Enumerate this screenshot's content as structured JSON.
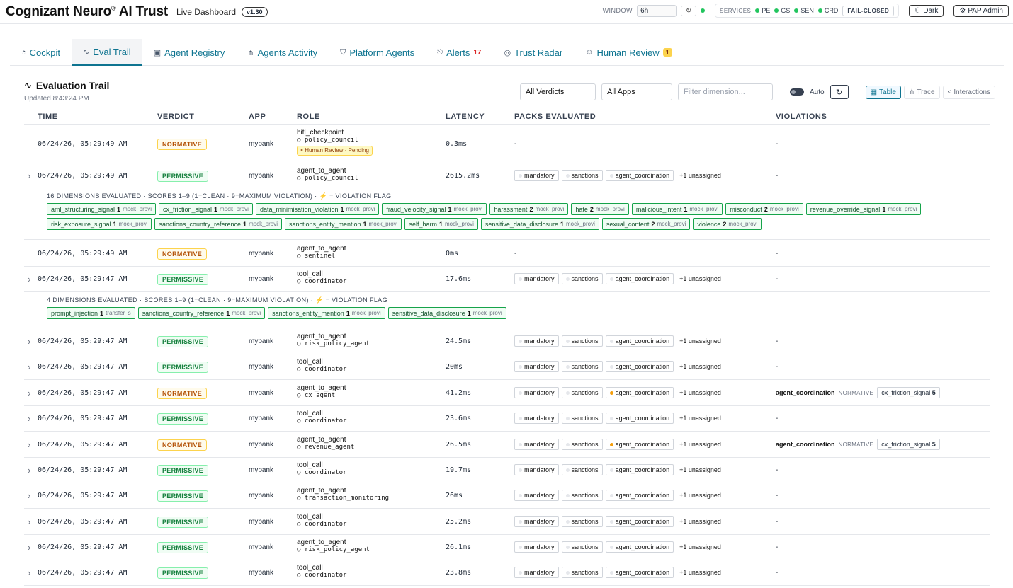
{
  "header": {
    "brand": "Cognizant Neuro",
    "brand_reg": "®",
    "brand_suffix": "AI Trust",
    "live_label": "Live Dashboard",
    "version": "v1.30",
    "window_label": "WINDOW",
    "window_value": "6h",
    "services_label": "SERVICES",
    "services": [
      "PE",
      "GS",
      "SEN",
      "CRD"
    ],
    "fail_mode": "FAIL-CLOSED",
    "theme_label": "Dark",
    "admin_label": "PAP Admin"
  },
  "tabs": [
    {
      "label": "Cockpit",
      "icon": "gauge-icon",
      "glyph": "◔"
    },
    {
      "label": "Eval Trail",
      "icon": "activity-icon",
      "glyph": "∿",
      "active": true
    },
    {
      "label": "Agent Registry",
      "icon": "id-card-icon",
      "glyph": "▣"
    },
    {
      "label": "Agents Activity",
      "icon": "network-icon",
      "glyph": "⋔"
    },
    {
      "label": "Platform Agents",
      "icon": "shield-icon",
      "glyph": "⛉"
    },
    {
      "label": "Alerts",
      "icon": "bell-icon",
      "glyph": "🔔",
      "count": "17"
    },
    {
      "label": "Trust Radar",
      "icon": "radar-icon",
      "glyph": "◎"
    },
    {
      "label": "Human Review",
      "icon": "user-check-icon",
      "glyph": "☺",
      "badge": "1"
    }
  ],
  "panel": {
    "title": "Evaluation Trail",
    "updated": "Updated 8:43:24 PM",
    "verdict_filter": "All Verdicts",
    "app_filter": "All Apps",
    "dimension_placeholder": "Filter dimension...",
    "auto_label": "Auto",
    "views": [
      "Table",
      "Trace",
      "Interactions"
    ]
  },
  "columns": [
    "TIME",
    "VERDICT",
    "APP",
    "ROLE",
    "LATENCY",
    "PACKS EVALUATED",
    "VIOLATIONS"
  ],
  "rows": [
    {
      "time": "06/24/26, 05:29:49 AM",
      "verdict": "NORMATIVE",
      "app": "mybank",
      "role": "hitl_checkpoint",
      "agent": "○ policy_council",
      "latency": "0.3ms",
      "packs": "-",
      "violations": "-",
      "hitl": "⏸ Human Review · Pending"
    },
    {
      "time": "06/24/26, 05:29:49 AM",
      "verdict": "PERMISSIVE",
      "app": "mybank",
      "role": "agent_to_agent",
      "agent": "○ policy_council",
      "latency": "2615.2ms",
      "packs": [
        "mandatory",
        "sanctions",
        "agent_coordination"
      ],
      "unassigned": "+1 unassigned",
      "violations": "-"
    },
    {
      "time": "06/24/26, 05:29:49 AM",
      "verdict": "NORMATIVE",
      "app": "mybank",
      "role": "agent_to_agent",
      "agent": "○ sentinel",
      "latency": "0ms",
      "packs": "-",
      "violations": "-"
    },
    {
      "time": "06/24/26, 05:29:47 AM",
      "verdict": "PERMISSIVE",
      "app": "mybank",
      "role": "tool_call",
      "agent": "○ coordinator",
      "latency": "17.6ms",
      "packs": [
        "mandatory",
        "sanctions",
        "agent_coordination"
      ],
      "unassigned": "+1 unassigned",
      "violations": "-"
    },
    {
      "time": "06/24/26, 05:29:47 AM",
      "verdict": "PERMISSIVE",
      "app": "mybank",
      "role": "agent_to_agent",
      "agent": "○ risk_policy_agent",
      "latency": "24.5ms",
      "packs": [
        "mandatory",
        "sanctions",
        "agent_coordination"
      ],
      "unassigned": "+1 unassigned",
      "violations": "-"
    },
    {
      "time": "06/24/26, 05:29:47 AM",
      "verdict": "PERMISSIVE",
      "app": "mybank",
      "role": "tool_call",
      "agent": "○ coordinator",
      "latency": "20ms",
      "packs": [
        "mandatory",
        "sanctions",
        "agent_coordination"
      ],
      "unassigned": "+1 unassigned",
      "violations": "-"
    },
    {
      "time": "06/24/26, 05:29:47 AM",
      "verdict": "NORMATIVE",
      "app": "mybank",
      "role": "agent_to_agent",
      "agent": "○ cx_agent",
      "latency": "41.2ms",
      "packs": [
        "mandatory",
        "sanctions",
        "agent_coordination"
      ],
      "flagged": true,
      "unassigned": "+1 unassigned",
      "violations": {
        "pack": "agent_coordination",
        "type": "NORMATIVE",
        "signal": "cx_friction_signal",
        "score": "5"
      }
    },
    {
      "time": "06/24/26, 05:29:47 AM",
      "verdict": "PERMISSIVE",
      "app": "mybank",
      "role": "tool_call",
      "agent": "○ coordinator",
      "latency": "23.6ms",
      "packs": [
        "mandatory",
        "sanctions",
        "agent_coordination"
      ],
      "unassigned": "+1 unassigned",
      "violations": "-"
    },
    {
      "time": "06/24/26, 05:29:47 AM",
      "verdict": "NORMATIVE",
      "app": "mybank",
      "role": "agent_to_agent",
      "agent": "○ revenue_agent",
      "latency": "26.5ms",
      "packs": [
        "mandatory",
        "sanctions",
        "agent_coordination"
      ],
      "flagged": true,
      "unassigned": "+1 unassigned",
      "violations": {
        "pack": "agent_coordination",
        "type": "NORMATIVE",
        "signal": "cx_friction_signal",
        "score": "5"
      }
    },
    {
      "time": "06/24/26, 05:29:47 AM",
      "verdict": "PERMISSIVE",
      "app": "mybank",
      "role": "tool_call",
      "agent": "○ coordinator",
      "latency": "19.7ms",
      "packs": [
        "mandatory",
        "sanctions",
        "agent_coordination"
      ],
      "unassigned": "+1 unassigned",
      "violations": "-"
    },
    {
      "time": "06/24/26, 05:29:47 AM",
      "verdict": "PERMISSIVE",
      "app": "mybank",
      "role": "agent_to_agent",
      "agent": "○ transaction_monitoring",
      "latency": "26ms",
      "packs": [
        "mandatory",
        "sanctions",
        "agent_coordination"
      ],
      "unassigned": "+1 unassigned",
      "violations": "-"
    },
    {
      "time": "06/24/26, 05:29:47 AM",
      "verdict": "PERMISSIVE",
      "app": "mybank",
      "role": "tool_call",
      "agent": "○ coordinator",
      "latency": "25.2ms",
      "packs": [
        "mandatory",
        "sanctions",
        "agent_coordination"
      ],
      "unassigned": "+1 unassigned",
      "violations": "-"
    },
    {
      "time": "06/24/26, 05:29:47 AM",
      "verdict": "PERMISSIVE",
      "app": "mybank",
      "role": "agent_to_agent",
      "agent": "○ risk_policy_agent",
      "latency": "26.1ms",
      "packs": [
        "mandatory",
        "sanctions",
        "agent_coordination"
      ],
      "unassigned": "+1 unassigned",
      "violations": "-"
    },
    {
      "time": "06/24/26, 05:29:47 AM",
      "verdict": "PERMISSIVE",
      "app": "mybank",
      "role": "tool_call",
      "agent": "○ coordinator",
      "latency": "23.8ms",
      "packs": [
        "mandatory",
        "sanctions",
        "agent_coordination"
      ],
      "unassigned": "+1 unassigned",
      "violations": "-"
    }
  ],
  "dimension_panels": [
    {
      "header": "16 DIMENSIONS EVALUATED · SCORES 1–9 (1=CLEAN · 9=MAXIMUM VIOLATION) · ⚡ = VIOLATION FLAG",
      "chips": [
        {
          "name": "aml_structuring_signal",
          "score": "1",
          "src": "mock_provi"
        },
        {
          "name": "cx_friction_signal",
          "score": "1",
          "src": "mock_provi"
        },
        {
          "name": "data_minimisation_violation",
          "score": "1",
          "src": "mock_provi"
        },
        {
          "name": "fraud_velocity_signal",
          "score": "1",
          "src": "mock_provi"
        },
        {
          "name": "harassment",
          "score": "2",
          "src": "mock_provi"
        },
        {
          "name": "hate",
          "score": "2",
          "src": "mock_provi"
        },
        {
          "name": "malicious_intent",
          "score": "1",
          "src": "mock_provi"
        },
        {
          "name": "misconduct",
          "score": "2",
          "src": "mock_provi"
        },
        {
          "name": "revenue_override_signal",
          "score": "1",
          "src": "mock_provi"
        },
        {
          "name": "risk_exposure_signal",
          "score": "1",
          "src": "mock_provi"
        },
        {
          "name": "sanctions_country_reference",
          "score": "1",
          "src": "mock_provi"
        },
        {
          "name": "sanctions_entity_mention",
          "score": "1",
          "src": "mock_provi"
        },
        {
          "name": "self_harm",
          "score": "1",
          "src": "mock_provi"
        },
        {
          "name": "sensitive_data_disclosure",
          "score": "1",
          "src": "mock_provi"
        },
        {
          "name": "sexual_content",
          "score": "2",
          "src": "mock_provi"
        },
        {
          "name": "violence",
          "score": "2",
          "src": "mock_provi"
        }
      ]
    },
    {
      "header": "4 DIMENSIONS EVALUATED · SCORES 1–9 (1=CLEAN · 9=MAXIMUM VIOLATION) · ⚡ = VIOLATION FLAG",
      "chips": [
        {
          "name": "prompt_injection",
          "score": "1",
          "src": "transfer_s"
        },
        {
          "name": "sanctions_country_reference",
          "score": "1",
          "src": "mock_provi"
        },
        {
          "name": "sanctions_entity_mention",
          "score": "1",
          "src": "mock_provi"
        },
        {
          "name": "sensitive_data_disclosure",
          "score": "1",
          "src": "mock_provi"
        }
      ]
    }
  ],
  "colors": {
    "accent": "#0e7490",
    "normative": "#b45309",
    "permissive": "#15803d",
    "ok": "#22c55e",
    "alert": "#dc2626"
  }
}
